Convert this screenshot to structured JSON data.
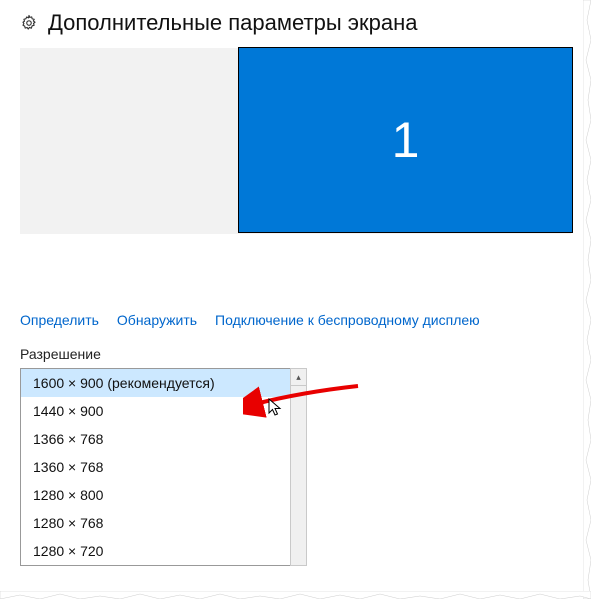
{
  "header": {
    "title": "Дополнительные параметры экрана"
  },
  "display": {
    "monitor_number": "1"
  },
  "links": {
    "identify": "Определить",
    "detect": "Обнаружить",
    "wireless": "Подключение к беспроводному дисплею"
  },
  "resolution": {
    "label": "Разрешение",
    "options": [
      "1600 × 900 (рекомендуется)",
      "1440 × 900",
      "1366 × 768",
      "1360 × 768",
      "1280 × 800",
      "1280 × 768",
      "1280 × 720"
    ],
    "selected_index": 0
  },
  "colors": {
    "accent": "#0078d7",
    "link": "#0066cc",
    "highlight": "#cce8ff"
  }
}
